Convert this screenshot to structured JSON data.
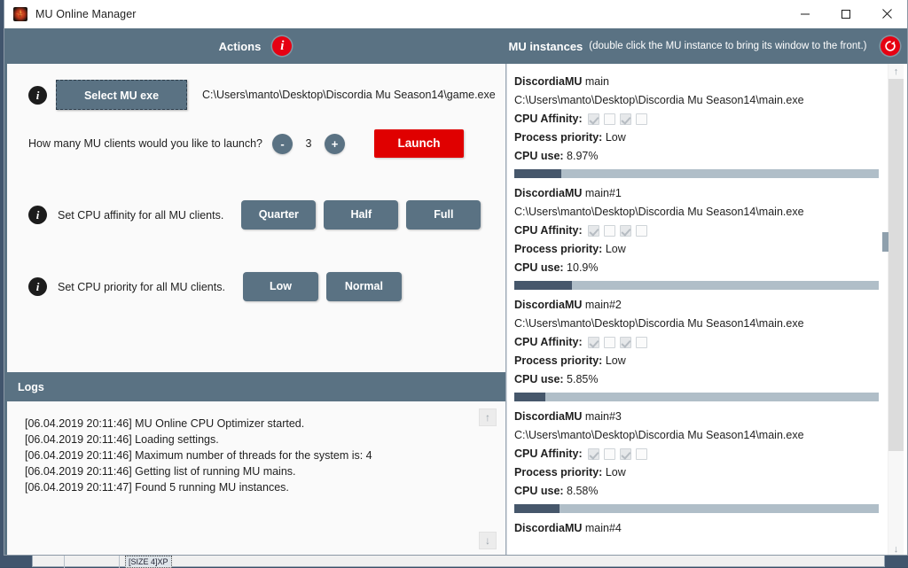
{
  "window": {
    "title": "MU Online Manager",
    "app_icon": "mu-logo-icon",
    "minimize": "—",
    "maximize": "□",
    "close": "✕"
  },
  "header": {
    "actions_title": "Actions",
    "actions_info_icon": "info-icon",
    "instances_title": "MU instances",
    "instances_hint": "(double click the MU instance to bring its window to the front.)",
    "refresh_icon": "refresh-icon"
  },
  "actions": {
    "select_exe_label": "Select MU exe",
    "exe_path": "C:\\Users\\manto\\Desktop\\Discordia Mu Season14\\game.exe",
    "clients_question": "How many MU clients would you like to launch?",
    "decrement_label": "-",
    "client_count": "3",
    "increment_label": "+",
    "launch_label": "Launch",
    "affinity_label": "Set CPU affinity for all MU clients.",
    "affinity_buttons": [
      "Quarter",
      "Half",
      "Full"
    ],
    "priority_label": "Set CPU priority for all MU clients.",
    "priority_buttons": [
      "Low",
      "Normal"
    ]
  },
  "logs": {
    "title": "Logs",
    "scroll_up_icon": "arrow-up-icon",
    "scroll_down_icon": "arrow-down-icon",
    "lines": [
      "[06.04.2019 20:11:46] MU Online CPU Optimizer started.",
      "[06.04.2019 20:11:46] Loading settings.",
      "[06.04.2019 20:11:46] Maximum number of threads for the system is: 4",
      "[06.04.2019 20:11:46] Getting list of running MU mains.",
      "[06.04.2019 20:11:47] Found 5 running MU instances."
    ]
  },
  "instances": {
    "labels": {
      "affinity": "CPU Affinity:",
      "priority": "Process priority:",
      "cpu_use": "CPU use:"
    },
    "scroll_up_icon": "arrow-up-icon",
    "scroll_down_icon": "arrow-down-icon",
    "items": [
      {
        "server": "DiscordiaMU",
        "process": "main",
        "path": "C:\\Users\\manto\\Desktop\\Discordia Mu Season14\\main.exe",
        "affinity": [
          true,
          false,
          true,
          false
        ],
        "priority": "Low",
        "cpu_use": "8.97%",
        "cpu_pct": 8.97
      },
      {
        "server": "DiscordiaMU",
        "process": "main#1",
        "path": "C:\\Users\\manto\\Desktop\\Discordia Mu Season14\\main.exe",
        "affinity": [
          true,
          false,
          true,
          false
        ],
        "priority": "Low",
        "cpu_use": "10.9%",
        "cpu_pct": 10.9
      },
      {
        "server": "DiscordiaMU",
        "process": "main#2",
        "path": "C:\\Users\\manto\\Desktop\\Discordia Mu Season14\\main.exe",
        "affinity": [
          true,
          false,
          true,
          false
        ],
        "priority": "Low",
        "cpu_use": "5.85%",
        "cpu_pct": 5.85
      },
      {
        "server": "DiscordiaMU",
        "process": "main#3",
        "path": "C:\\Users\\manto\\Desktop\\Discordia Mu Season14\\main.exe",
        "affinity": [
          true,
          false,
          true,
          false
        ],
        "priority": "Low",
        "cpu_use": "8.58%",
        "cpu_pct": 8.58
      },
      {
        "server": "DiscordiaMU",
        "process": "main#4",
        "path": "",
        "affinity": [],
        "priority": "",
        "cpu_use": "",
        "cpu_pct": 0,
        "partial": true
      }
    ]
  },
  "background_window": {
    "cell_label": "[SIZE  4]XP"
  },
  "colors": {
    "header_band": "#5a7283",
    "accent_red": "#e60012",
    "launch_red": "#e00000",
    "button": "#5a7283",
    "progress_fill": "#46576b",
    "progress_track": "#b0bec8"
  }
}
